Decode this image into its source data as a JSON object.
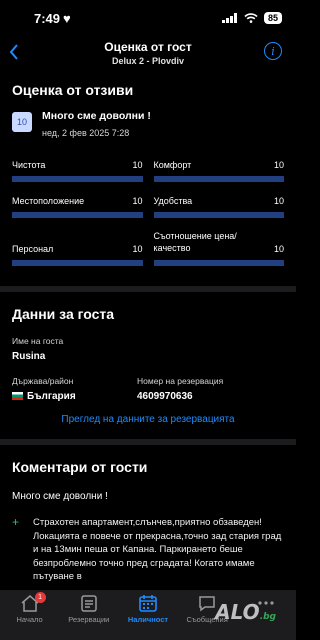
{
  "status": {
    "time": "7:49",
    "battery": "85"
  },
  "nav": {
    "title": "Оценка от гост",
    "subtitle": "Delux 2 - Plovdiv"
  },
  "review_section": {
    "title": "Оценка от отзиви",
    "score": "10",
    "review_title": "Много сме доволни !",
    "date": "нед, 2 фев 2025 7:28",
    "categories": [
      {
        "label": "Чистота",
        "value": "10",
        "fraction": 1.0
      },
      {
        "label": "Комфорт",
        "value": "10",
        "fraction": 1.0
      },
      {
        "label": "Местоположение",
        "value": "10",
        "fraction": 1.0
      },
      {
        "label": "Удобства",
        "value": "10",
        "fraction": 1.0
      },
      {
        "label": "Персонал",
        "value": "10",
        "fraction": 1.0
      },
      {
        "label": "Съотношение цена/ качество",
        "value": "10",
        "fraction": 1.0
      }
    ]
  },
  "guest_section": {
    "title": "Данни за госта",
    "name_label": "Име на госта",
    "name": "Rusina",
    "country_label": "Държава/район",
    "country": "България",
    "reservation_label": "Номер на резервация",
    "reservation_number": "4609970636",
    "link": "Преглед на данните за резервацията"
  },
  "comments_section": {
    "title": "Коментари от гости",
    "heading": "Много сме доволни !",
    "positive_text": "Страхотен апартамент,слънчев,приятно обзаведен! Локацията е повече от прекрасна,точно зад стария град и на 13мин пеша от Капана. Паркирането беше безпроблемно точно пред сградата! Когато имаме пътуване в"
  },
  "tabbar": {
    "tabs": [
      {
        "label": "Начало",
        "badge": "1"
      },
      {
        "label": "Резервации"
      },
      {
        "label": "Наличност"
      },
      {
        "label": "Съобщения"
      },
      {
        "label": ""
      }
    ]
  },
  "watermark": {
    "text": "ALO",
    "suffix": ".bg"
  },
  "colors": {
    "accent": "#1e8bff",
    "bar": "#22407f",
    "positive": "#35c15a",
    "badge": "#e53a3a"
  }
}
